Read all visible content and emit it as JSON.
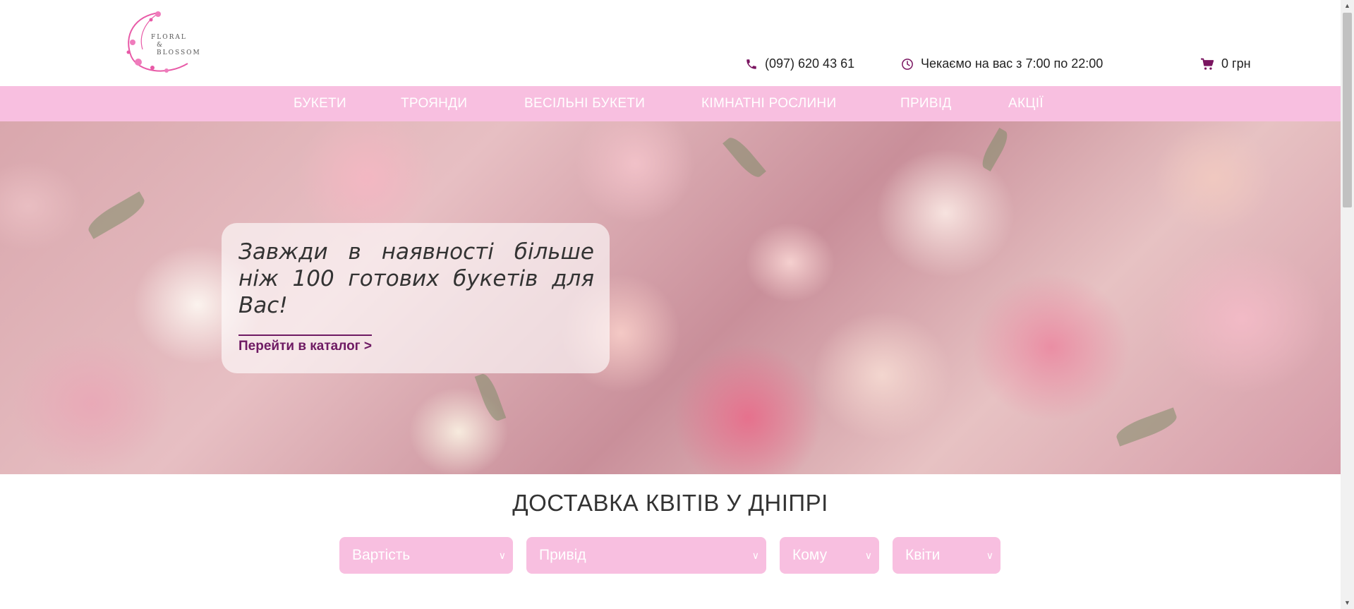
{
  "header": {
    "logo_text": [
      "FLORAL",
      "& BLOSSOM"
    ],
    "phone": "(097) 620 43 61",
    "hours": "Чекаємо на вас з 7:00 по 22:00",
    "cart": "0 грн"
  },
  "nav": {
    "items": [
      "БУКЕТИ",
      "ТРОЯНДИ",
      "ВЕСІЛЬНІ БУКЕТИ",
      "КІМНАТНІ РОСЛИНИ",
      "ПРИВІД",
      "АКЦІЇ"
    ]
  },
  "hero": {
    "caption": "Завжди в наявності більше ніж 100 готових букетів для Вас!",
    "link": "Перейти в каталог >"
  },
  "section": {
    "title": "ДОСТАВКА КВІТІВ У ДНІПРІ"
  },
  "filters": [
    {
      "label": "Вартість",
      "icon": "chevron-down-icon"
    },
    {
      "label": "Привід",
      "icon": "chevron-down-icon"
    },
    {
      "label": "Кому",
      "icon": "chevron-down-icon"
    },
    {
      "label": "Квіти",
      "icon": "chevron-down-icon"
    }
  ],
  "colors": {
    "nav_bg": "#f8bfe0",
    "accent": "#6e1a63",
    "icon": "#7a1560"
  }
}
